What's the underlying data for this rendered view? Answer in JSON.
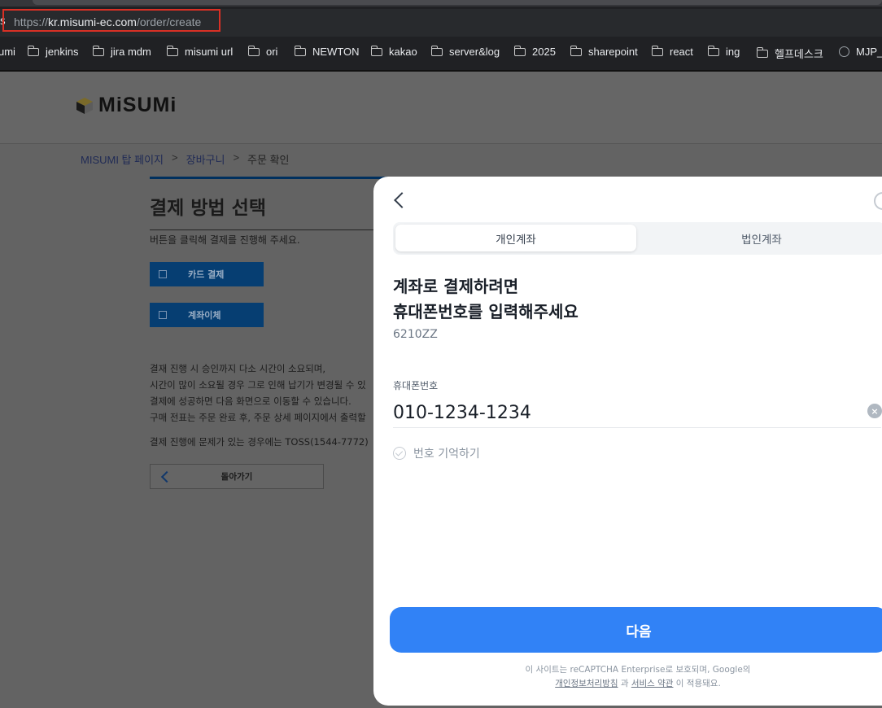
{
  "browser": {
    "url_prefix": "https://",
    "url_host": "kr.misumi-ec.com",
    "url_path": "/order/create",
    "left_fragment": "s",
    "bookmarks": [
      "umi",
      "jenkins",
      "jira mdm",
      "misumi url",
      "ori",
      "NEWTON",
      "kakao",
      "server&log",
      "2025",
      "sharepoint",
      "react",
      "ing",
      "헬프데스크",
      "MJP_R"
    ]
  },
  "site": {
    "logo_text": "MiSUMi",
    "breadcrumb": [
      "MISUMI 탑 페이지",
      "장바구니",
      "주문 확인"
    ],
    "breadcrumb_separator": ">",
    "page_title": "결제 방법 선택",
    "instruction": "버튼을 클릭해 결제를 진행해 주세요.",
    "card_button": "카드 결제",
    "transfer_button": "계좌이체",
    "notes": [
      "결재 진행 시 승인까지 다소 시간이 소요되며,",
      "시간이 많이 소요될 경우 그로 인해 납기가 변경될 수 있",
      "결제에 성공하면 다음 화면으로 이동할 수 있습니다.",
      "구매 전표는 주문 완료 후, 주문 상세 페이지에서 출력할"
    ],
    "contact_note": "결제 진행에 문제가 있는 경우에는 TOSS(1544-7772)",
    "back_button": "돌아가기"
  },
  "modal": {
    "tab_personal": "개인계좌",
    "tab_business": "법인계좌",
    "heading_line1": "계좌로 결제하려면",
    "heading_line2": "휴대폰번호를 입력해주세요",
    "order_code": "6210ZZ",
    "phone_label": "휴대폰번호",
    "phone_value": "010-1234-1234",
    "clear_symbol": "×",
    "remember_label": "번호 기억하기",
    "next_button": "다음",
    "recaptcha_line1": "이 사이트는 reCAPTCHA Enterprise로 보호되며, Google의",
    "privacy_link": "개인정보처리방침",
    "recaptcha_and": " 과 ",
    "terms_link": "서비스 약관",
    "recaptcha_tail": " 이 적용돼요."
  },
  "colors": {
    "accent_blue": "#3182f6",
    "misumi_navy": "#063e72",
    "url_highlight": "#d93025"
  }
}
